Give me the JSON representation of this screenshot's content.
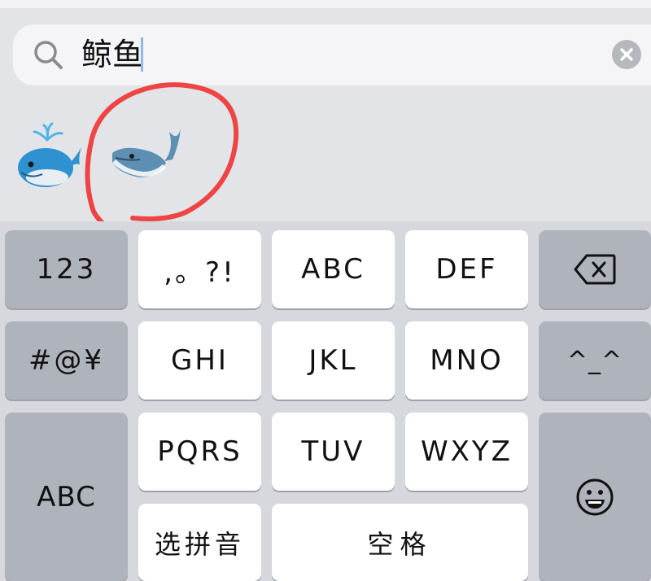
{
  "search": {
    "query": "鲸鱼",
    "icon": "search-icon",
    "clear_icon": "clear-icon"
  },
  "results": [
    {
      "name": "spouting-whale",
      "emoji": "🐳"
    },
    {
      "name": "whale",
      "emoji": "🐋",
      "highlighted": true
    }
  ],
  "keyboard": {
    "row1": {
      "num": "123",
      "punct": ",。?!",
      "abc": "ABC",
      "def": "DEF",
      "backspace": "backspace-icon"
    },
    "row2": {
      "symbols": "#@¥",
      "ghi": "GHI",
      "jkl": "JKL",
      "mno": "MNO",
      "kaomoji": "^_^"
    },
    "row3": {
      "pqrs": "PQRS",
      "tuv": "TUV",
      "wxyz": "WXYZ"
    },
    "row4": {
      "pinyin": "选拼音",
      "space": "空格"
    },
    "left": {
      "abc": "ABC"
    },
    "right": {
      "emoji": "smiley-face-icon"
    }
  },
  "colors": {
    "annotation": "#ee4444",
    "key_white": "#ffffff",
    "key_gray": "#aeb3bc",
    "background": "#e3e4e8"
  }
}
